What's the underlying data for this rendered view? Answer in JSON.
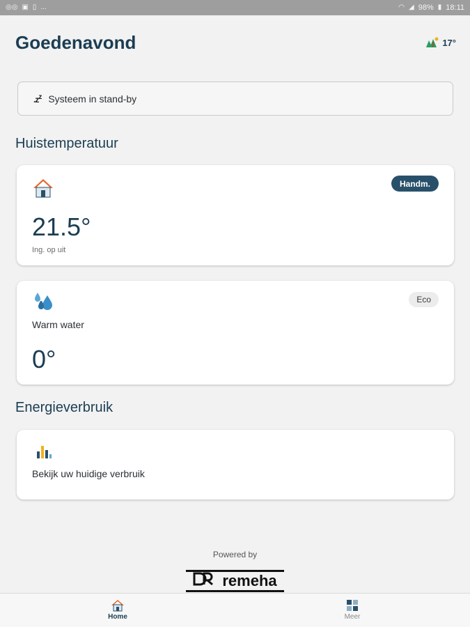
{
  "status_bar": {
    "battery": "98%",
    "time": "18:11"
  },
  "header": {
    "greeting": "Goedenavond",
    "weather_temp": "17°",
    "weather_icon": "landscape-icon"
  },
  "system_status": {
    "icon": "sleep-zz-icon",
    "text": "Systeem in stand-by"
  },
  "sections": {
    "house_title": "Huistemperatuur",
    "energy_title": "Energieverbruik"
  },
  "house_card": {
    "icon": "house-icon",
    "mode_badge": "Handm.",
    "temperature": "21.5°",
    "setting_label": "Ing. op uit"
  },
  "water_card": {
    "icon": "water-drops-icon",
    "mode_badge": "Eco",
    "label": "Warm water",
    "temperature": "0°"
  },
  "energy_card": {
    "icon": "bar-chart-icon",
    "label": "Bekijk uw huidige verbruik"
  },
  "footer": {
    "powered_by": "Powered by",
    "brand": "remeha"
  },
  "bottom_nav": {
    "items": [
      {
        "label": "Home",
        "icon": "house-icon",
        "active": true
      },
      {
        "label": "Meer",
        "icon": "grid-icon",
        "active": false
      }
    ]
  },
  "colors": {
    "primary": "#1b3d52",
    "badge_dark": "#29506a",
    "background": "#f2f2f2",
    "status_bar": "#9e9e9e"
  }
}
